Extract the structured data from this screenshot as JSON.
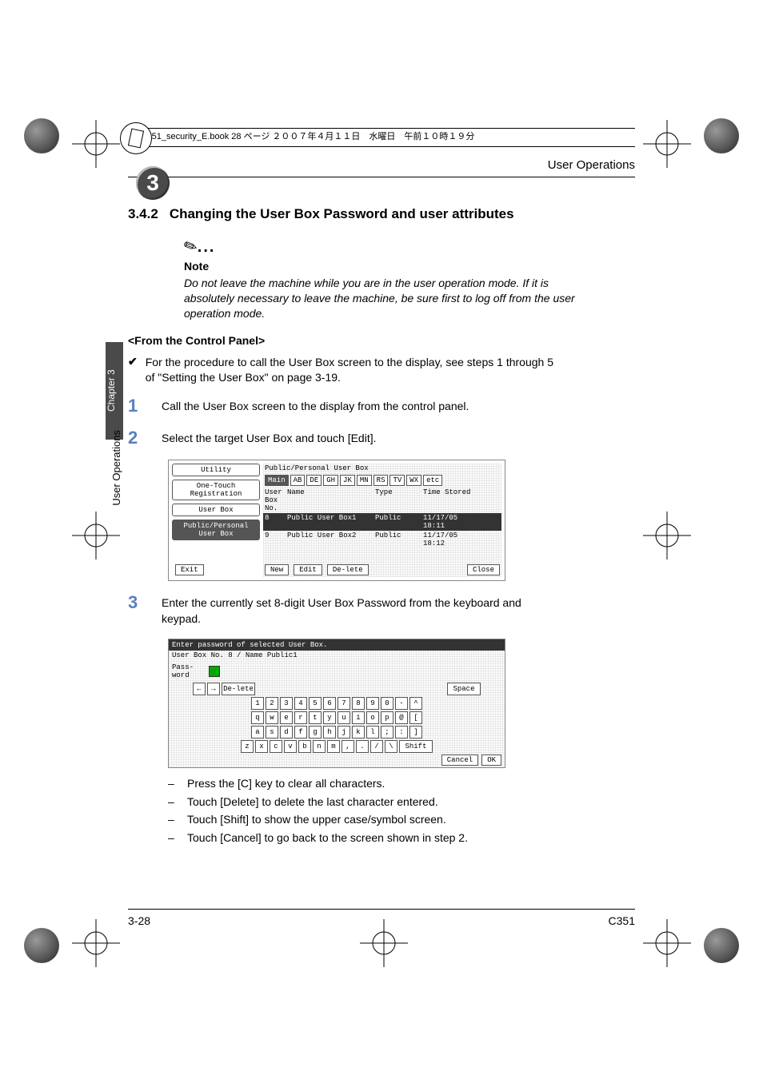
{
  "header_strip": "c351_security_E.book  28 ページ  ２００７年４月１１日　水曜日　午前１０時１９分",
  "running_head": "User Operations",
  "chapter_badge": "3",
  "side_tab": "Chapter 3",
  "side_text": "User Operations",
  "section": {
    "number": "3.4.2",
    "title": "Changing the User Box Password and user attributes"
  },
  "note": {
    "label": "Note",
    "body": "Do not leave the machine while you are in the user operation mode. If it is absolutely necessary to leave the machine, be sure first to log off from the user operation mode."
  },
  "subhead": "<From the Control Panel>",
  "check_item": "For the procedure to call the User Box screen to the display, see steps 1 through 5 of \"Setting the User Box\" on page 3-19.",
  "steps": {
    "s1": {
      "num": "1",
      "text": "Call the User Box screen to the display from the control panel."
    },
    "s2": {
      "num": "2",
      "text": "Select the target User Box and touch [Edit]."
    },
    "s3": {
      "num": "3",
      "text": "Enter the currently set 8-digit User Box Password from the keyboard and keypad."
    }
  },
  "screenshot1": {
    "title": "Public/Personal User Box",
    "left_buttons": [
      "Utility",
      "One-Touch Registration",
      "User Box",
      "Public/Personal User Box"
    ],
    "tabs": [
      "Main",
      "AB",
      "DE",
      "GH",
      "JK",
      "MN",
      "RS",
      "TV",
      "WX",
      "etc"
    ],
    "columns": [
      "User Box No.",
      "Name",
      "Type",
      "Time Stored"
    ],
    "rows": [
      {
        "no": "8",
        "name": "Public User Box1",
        "type": "Public",
        "time": "11/17/05 18:11"
      },
      {
        "no": "9",
        "name": "Public User Box2",
        "type": "Public",
        "time": "11/17/05 18:12"
      }
    ],
    "bottom": {
      "exit": "Exit",
      "new": "New",
      "edit": "Edit",
      "delete": "De-lete",
      "close": "Close"
    }
  },
  "screenshot2": {
    "header": "Enter password of selected User Box.",
    "subheader_left": "User Box No.",
    "subheader_no": "8",
    "subheader_sep": "/ Name",
    "subheader_name": "Public1",
    "pass_label": "Pass-word",
    "top_keys": [
      "←",
      "→",
      "De-lete",
      "Space"
    ],
    "row1": [
      "1",
      "2",
      "3",
      "4",
      "5",
      "6",
      "7",
      "8",
      "9",
      "0",
      "-",
      "^"
    ],
    "row2": [
      "q",
      "w",
      "e",
      "r",
      "t",
      "y",
      "u",
      "i",
      "o",
      "p",
      "@",
      "["
    ],
    "row3": [
      "a",
      "s",
      "d",
      "f",
      "g",
      "h",
      "j",
      "k",
      "l",
      ";",
      ":",
      "]"
    ],
    "row4": [
      "z",
      "x",
      "c",
      "v",
      "b",
      "n",
      "m",
      ",",
      ".",
      "/",
      "\\",
      "Shift"
    ],
    "footer": {
      "cancel": "Cancel",
      "ok": "OK"
    }
  },
  "bullets": [
    "Press the [C] key to clear all characters.",
    "Touch [Delete] to delete the last character entered.",
    "Touch [Shift] to show the upper case/symbol screen.",
    "Touch [Cancel] to go back to the screen shown in step 2."
  ],
  "footer": {
    "left": "3-28",
    "right": "C351"
  }
}
